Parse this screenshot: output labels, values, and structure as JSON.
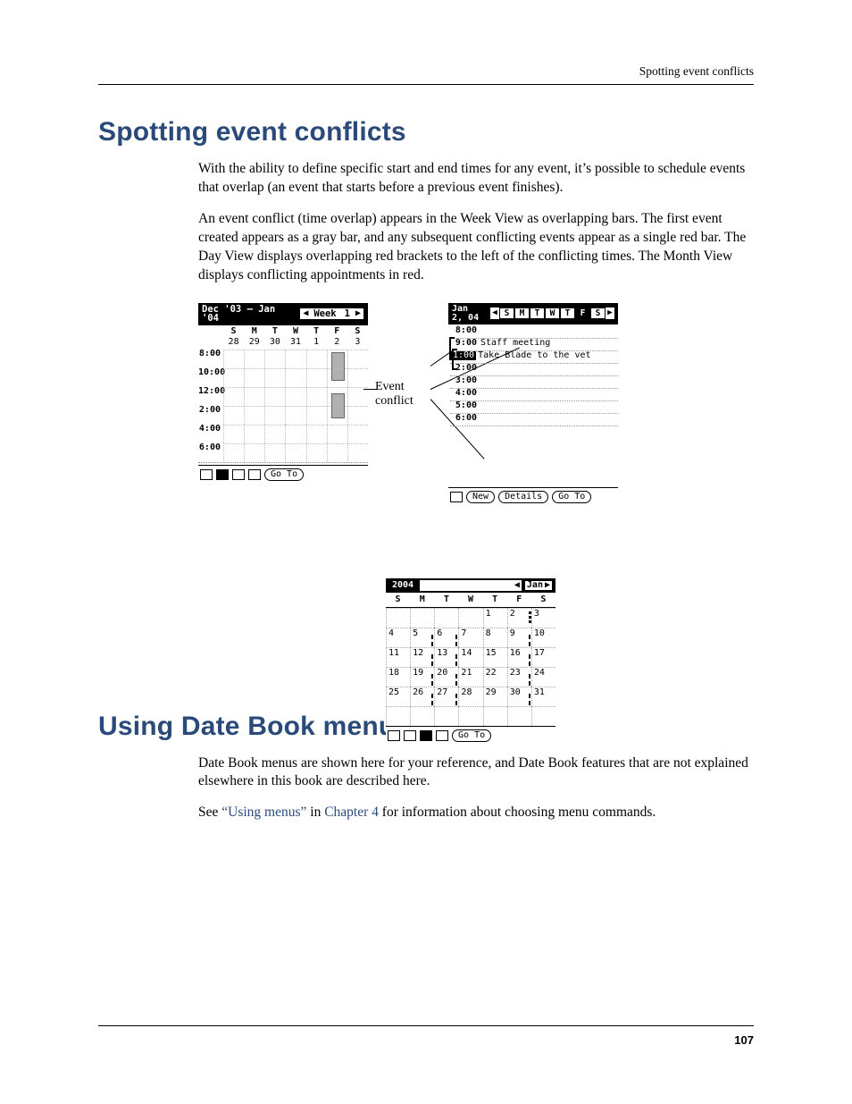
{
  "running_head": "Spotting event conflicts",
  "page_number": "107",
  "section1": {
    "title": "Spotting event conflicts",
    "p1": "With the ability to define specific start and end times for any event, it’s possible to schedule events that overlap (an event that starts before a previous event finishes).",
    "p2": "An event conflict (time overlap) appears in the Week View as overlapping bars. The first event created appears as a gray bar, and any subsequent conflicting events appear as a single red bar. The Day View displays overlapping red brackets to the left of the conflicting times. The Month View displays conflicting appointments in red."
  },
  "callout": {
    "line1": "Event",
    "line2": "conflict"
  },
  "week_view": {
    "title": "Dec '03 – Jan '04",
    "nav_label": "Week",
    "nav_value": "1",
    "day_heads": [
      "S",
      "M",
      "T",
      "W",
      "T",
      "F",
      "S"
    ],
    "dates": [
      "28",
      "29",
      "30",
      "31",
      "1",
      "2",
      "3"
    ],
    "times": [
      "8:00",
      "10:00",
      "12:00",
      "2:00",
      "4:00",
      "6:00"
    ],
    "goto": "Go To"
  },
  "month_view": {
    "year": "2004",
    "month": "Jan",
    "day_heads": [
      "S",
      "M",
      "T",
      "W",
      "T",
      "F",
      "S"
    ],
    "weeks": [
      [
        "",
        "",
        "",
        "",
        "1",
        "2",
        "3"
      ],
      [
        "4",
        "5",
        "6",
        "7",
        "8",
        "9",
        "10"
      ],
      [
        "11",
        "12",
        "13",
        "14",
        "15",
        "16",
        "17"
      ],
      [
        "18",
        "19",
        "20",
        "21",
        "22",
        "23",
        "24"
      ],
      [
        "25",
        "26",
        "27",
        "28",
        "29",
        "30",
        "31"
      ]
    ],
    "marks_small": [
      "5",
      "6",
      "9",
      "12",
      "13",
      "16",
      "19",
      "20",
      "23",
      "26",
      "27",
      "30"
    ],
    "conflict_day": "2",
    "goto": "Go To"
  },
  "day_view": {
    "title": "Jan 2, 04",
    "dow": [
      "S",
      "M",
      "T",
      "W",
      "T",
      "F",
      "S"
    ],
    "dow_selected": 5,
    "rows": [
      {
        "time": "8:00",
        "text": ""
      },
      {
        "time": "9:00",
        "text": "Staff meeting"
      },
      {
        "time_sel": "1:00",
        "text": "Take Blade to the vet"
      },
      {
        "time": "2:00",
        "text": ""
      },
      {
        "time": "3:00",
        "text": ""
      },
      {
        "time": "4:00",
        "text": ""
      },
      {
        "time": "5:00",
        "text": ""
      },
      {
        "time": "6:00",
        "text": ""
      }
    ],
    "btn_new": "New",
    "btn_details": "Details",
    "btn_goto": "Go To"
  },
  "section2": {
    "title": "Using Date Book menus",
    "p1": "Date Book menus are shown here for your reference, and Date Book features that are not explained elsewhere in this book are described here.",
    "p2_a": "See ",
    "p2_link1": "“Using menus”",
    "p2_b": " in ",
    "p2_link2": "Chapter 4",
    "p2_c": " for information about choosing menu commands."
  }
}
